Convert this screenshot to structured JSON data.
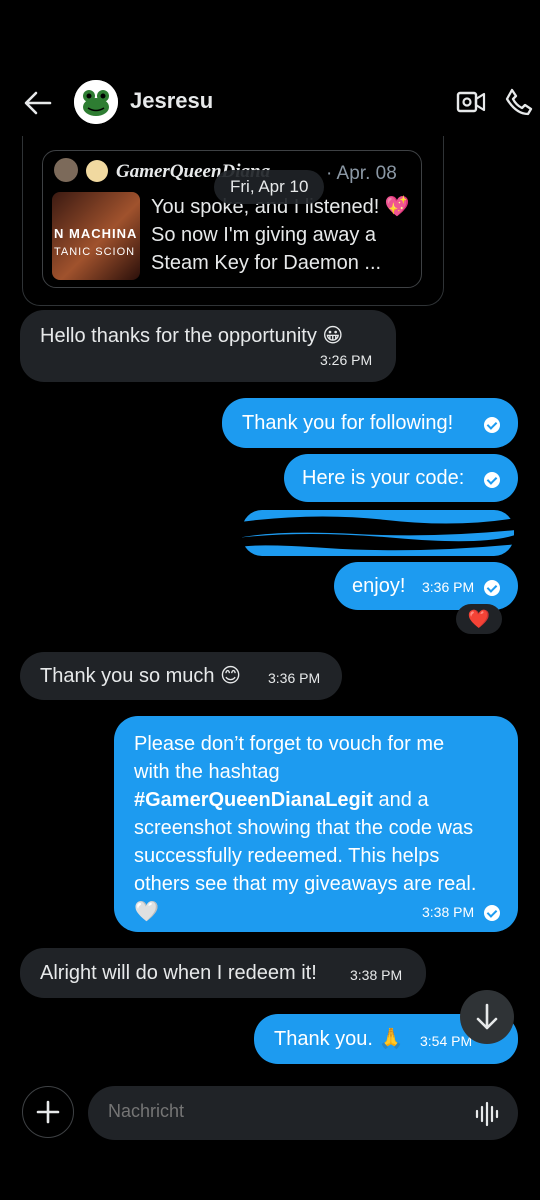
{
  "header": {
    "title": "Jesresu",
    "back_icon": "arrow-left-icon",
    "avatar_icon": "frog-avatar-icon",
    "video_icon": "video-call-icon",
    "phone_icon": "phone-icon"
  },
  "quoted_post": {
    "author": "GamerQueenDiana",
    "date": "· Apr. 08",
    "text": "You spoke, and I listened! 💖 So now I'm giving away a Steam Key for Daemon ...",
    "thumb_line1": "N MACHINA",
    "thumb_line2": "TANIC SCION"
  },
  "date_chip": "Fri, Apr 10",
  "messages": [
    {
      "side": "in",
      "text": "Hello thanks for the opportunity 😀",
      "time": "3:26 PM"
    },
    {
      "side": "out",
      "text": "Thank you for following!",
      "time": ""
    },
    {
      "side": "out",
      "text": "Here is your code:",
      "time": ""
    },
    {
      "side": "out",
      "text": "enjoy!",
      "time": "3:36 PM"
    },
    {
      "side": "in",
      "text": "Thank you so much 😊",
      "time": "3:36 PM"
    },
    {
      "side": "out",
      "text_parts": [
        "Please don’t forget to vouch for me with the hashtag ",
        "#GamerQueenDianaLegit",
        " and a screenshot showing that the code was successfully redeemed. This helps others see that my giveaways are real. 🤍"
      ],
      "time": "3:38 PM"
    },
    {
      "side": "in",
      "text": "Alright will do when I redeem it!",
      "time": "3:38 PM"
    },
    {
      "side": "out",
      "text": "Thank you. 🙏",
      "time": "3:54 PM"
    }
  ],
  "reaction": "❤️",
  "composer": {
    "placeholder": "Nachricht",
    "plus_icon": "plus-icon",
    "voice_icon": "voice-wave-icon"
  },
  "scroll_down_icon": "arrow-down-icon",
  "colors": {
    "outgoing": "#1d9bf0",
    "incoming": "#202327",
    "background": "#000000"
  }
}
